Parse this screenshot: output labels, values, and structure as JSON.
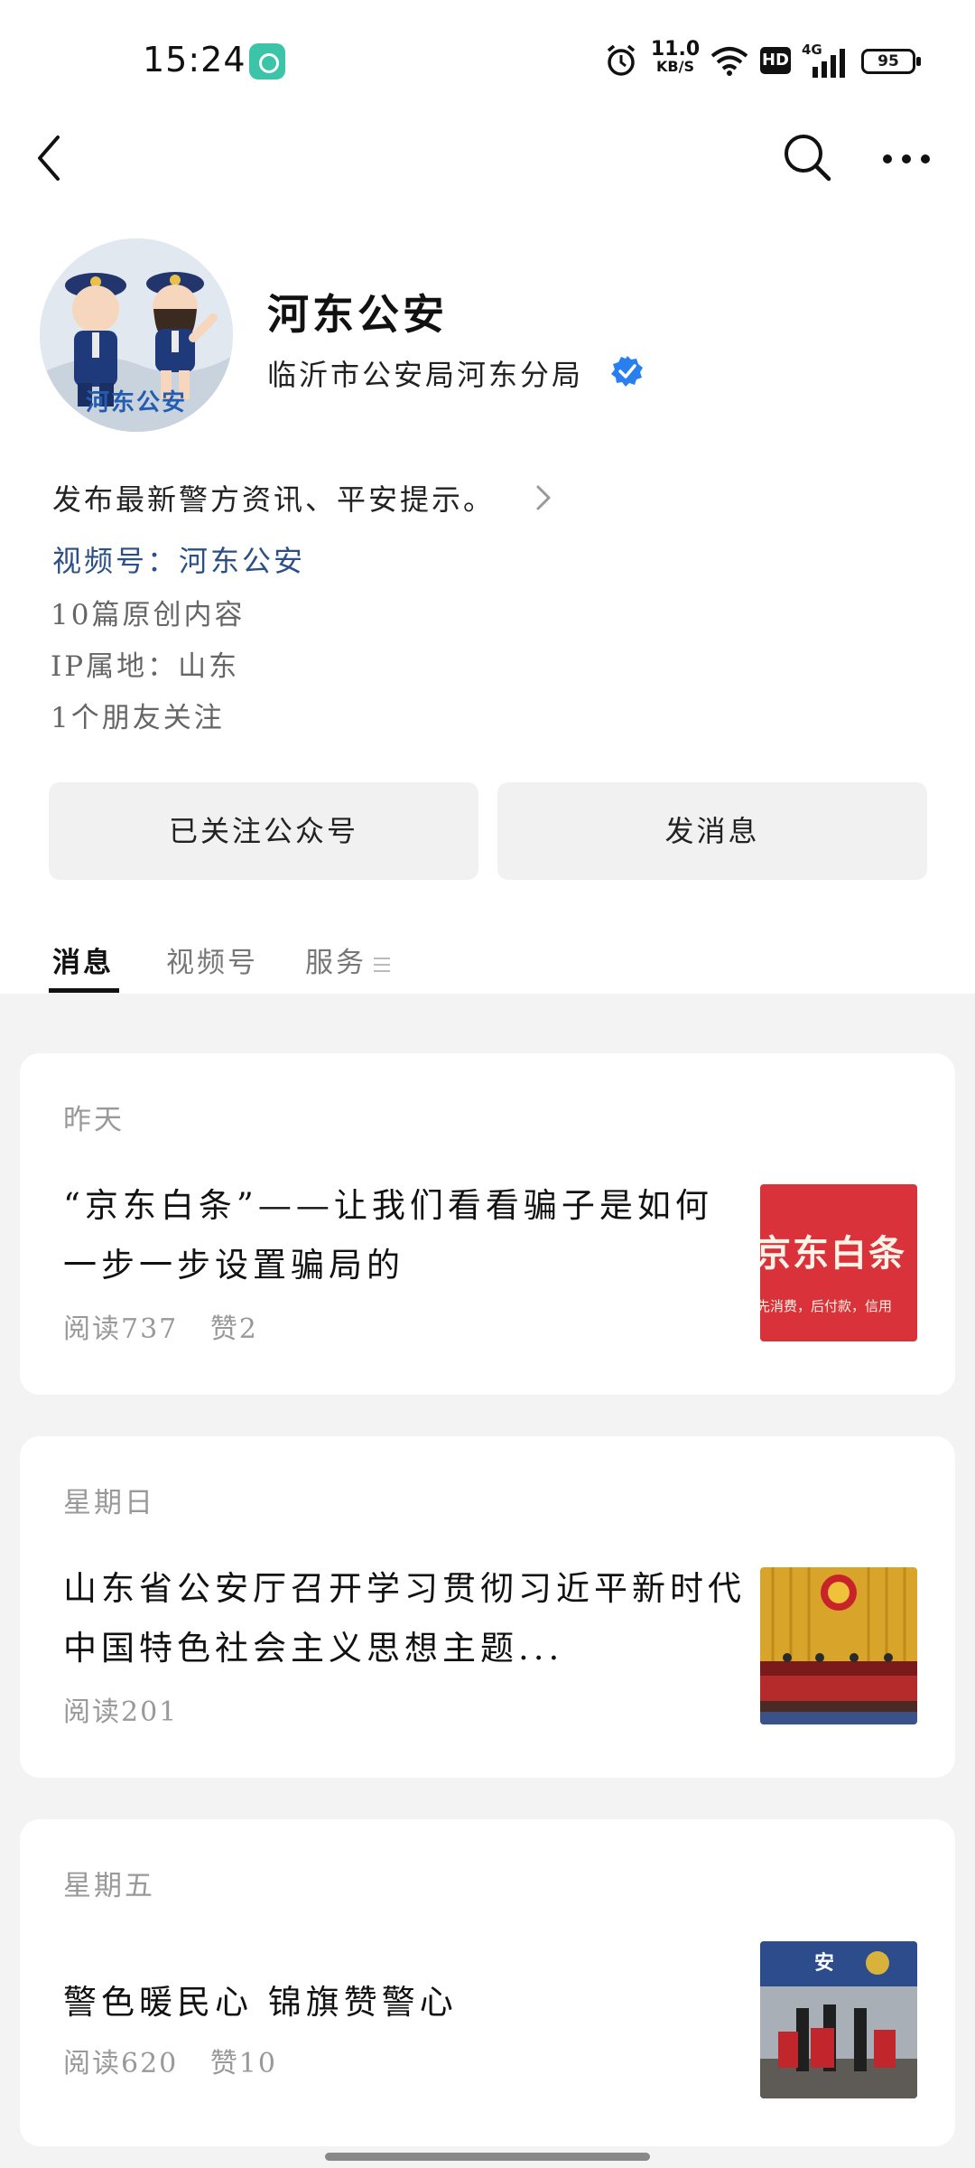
{
  "status_bar": {
    "time": "15:24",
    "net_speed_value": "11.0",
    "net_speed_unit": "KB/S",
    "hd_label": "HD",
    "network_label": "4G",
    "battery": "95"
  },
  "account": {
    "avatar_text": "河东公安",
    "name": "河东公安",
    "organization": "临沂市公安局河东分局",
    "description": "发布最新警方资讯、平安提示。",
    "channel_label": "视频号：河东公安",
    "original_count": "10篇原创内容",
    "ip_location": "IP属地：山东",
    "friends_following": "1个朋友关注"
  },
  "actions": {
    "followed_label": "已关注公众号",
    "message_label": "发消息"
  },
  "tabs": [
    {
      "label": "消息"
    },
    {
      "label": "视频号"
    },
    {
      "label": "服务"
    }
  ],
  "articles": [
    {
      "day": "昨天",
      "title": "“京东白条”——让我们看看骗子是如何一步一步设置骗局的",
      "reads": "阅读737",
      "likes": "赞2",
      "thumb_text": "京东白条",
      "thumb_subtext": "先消费，后付款，信用"
    },
    {
      "day": "星期日",
      "title": "山东省公安厅召开学习贯彻习近平新时代中国特色社会主义思想主题...",
      "reads": "阅读201",
      "likes": ""
    },
    {
      "day": "星期五",
      "title": "警色暖民心 锦旗赞警心",
      "reads": "阅读620",
      "likes": "赞10",
      "thumb_sign": "安"
    }
  ],
  "colors": {
    "accent_link": "#2b4f86",
    "verify_blue": "#2a7ff0",
    "page_bg": "#f3f3f3"
  }
}
